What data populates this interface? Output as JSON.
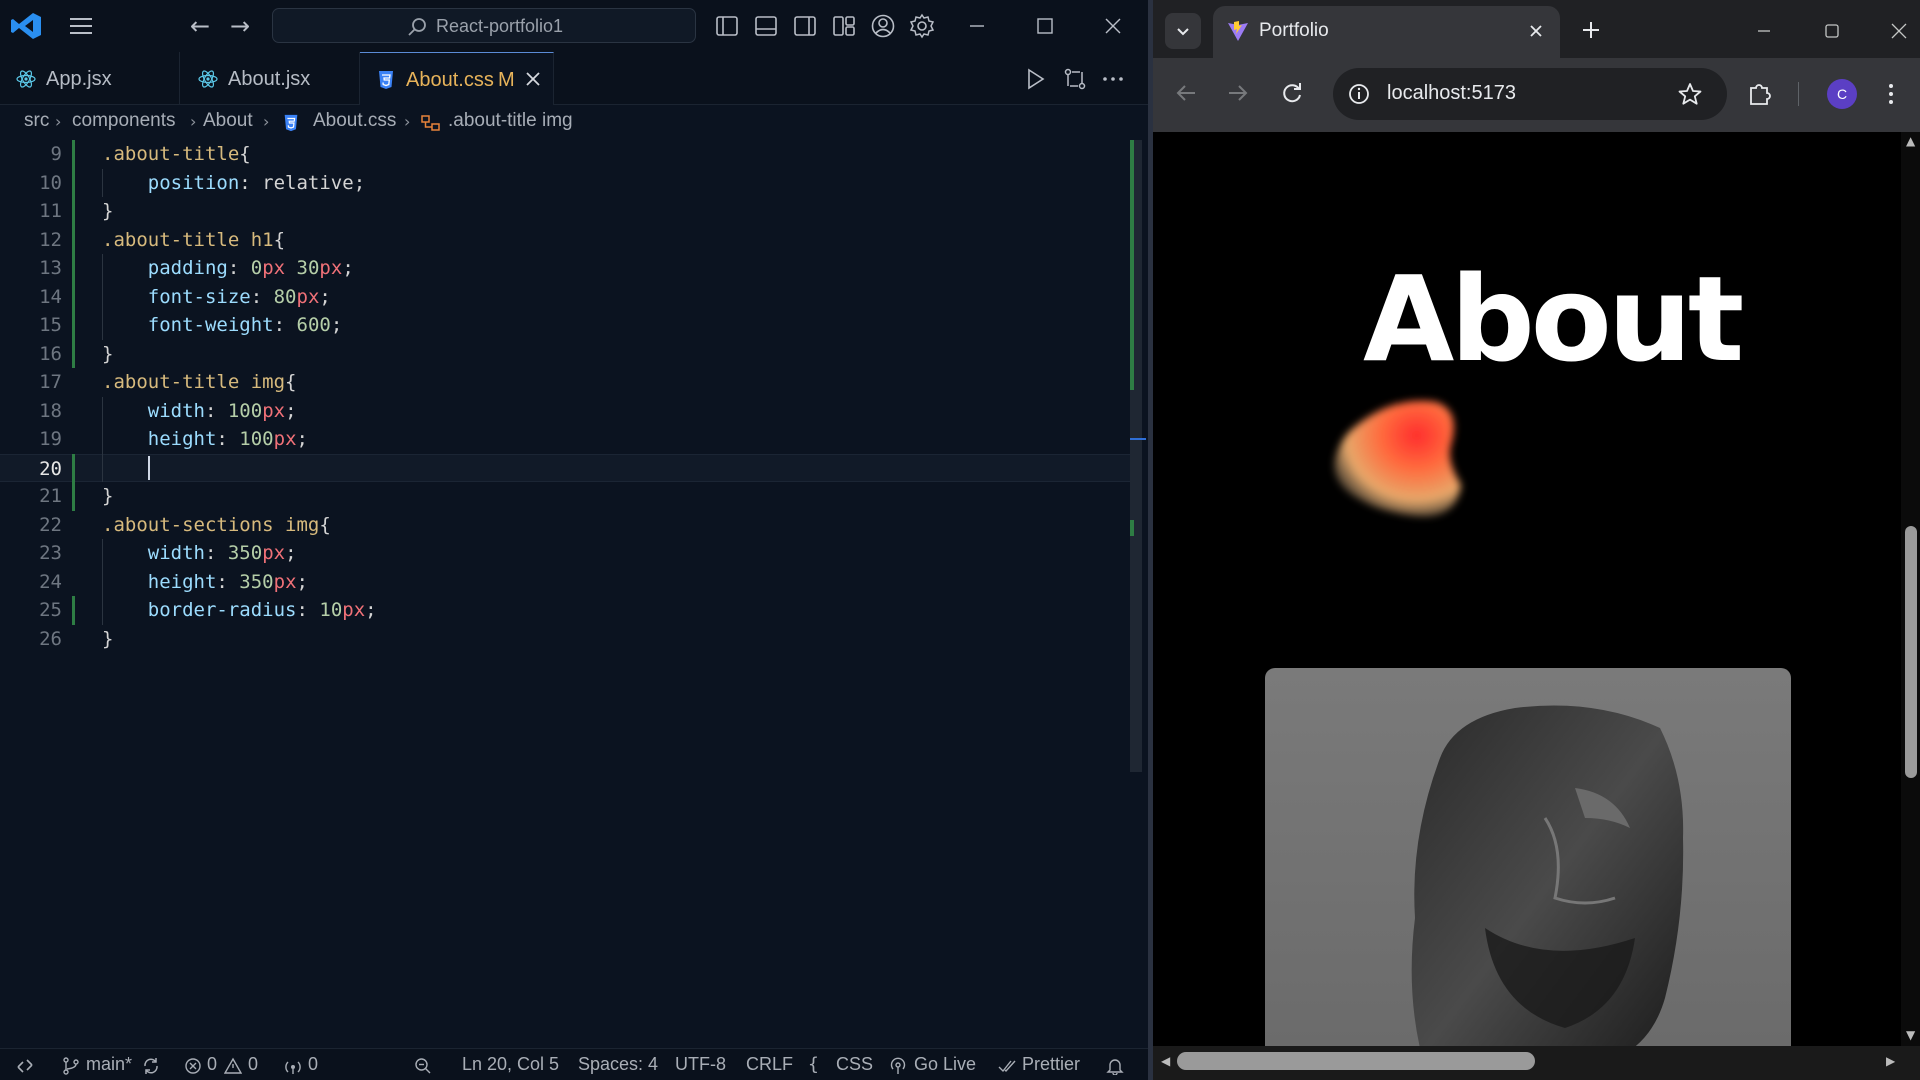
{
  "vscode": {
    "search_text": "React-portfolio1",
    "tabs": [
      {
        "label": "App.jsx",
        "icon": "react-icon"
      },
      {
        "label": "About.jsx",
        "icon": "react-icon"
      },
      {
        "label": "About.css",
        "icon": "css-icon",
        "modified": "M",
        "active": true
      }
    ],
    "breadcrumb": [
      "src",
      "components",
      "About",
      "About.css",
      ".about-title img"
    ],
    "lines": [
      {
        "n": "9",
        "tokens": [
          {
            "t": ".about-title",
            "c": "t-sel"
          },
          {
            "t": "{",
            "c": "t-brace"
          }
        ]
      },
      {
        "n": "10",
        "tokens": [
          {
            "t": "    ",
            "c": ""
          },
          {
            "t": "position",
            "c": "t-prop"
          },
          {
            "t": ": ",
            "c": "t-val"
          },
          {
            "t": "relative",
            "c": "t-val"
          },
          {
            "t": ";",
            "c": "t-val"
          }
        ]
      },
      {
        "n": "11",
        "tokens": [
          {
            "t": "}",
            "c": "t-brace"
          }
        ]
      },
      {
        "n": "12",
        "tokens": [
          {
            "t": ".about-title ",
            "c": "t-sel"
          },
          {
            "t": "h1",
            "c": "t-tag"
          },
          {
            "t": "{",
            "c": "t-brace"
          }
        ]
      },
      {
        "n": "13",
        "tokens": [
          {
            "t": "    ",
            "c": ""
          },
          {
            "t": "padding",
            "c": "t-prop"
          },
          {
            "t": ": ",
            "c": "t-val"
          },
          {
            "t": "0",
            "c": "t-num"
          },
          {
            "t": "px",
            "c": "t-unit"
          },
          {
            "t": " ",
            "c": ""
          },
          {
            "t": "30",
            "c": "t-num"
          },
          {
            "t": "px",
            "c": "t-unit"
          },
          {
            "t": ";",
            "c": "t-val"
          }
        ]
      },
      {
        "n": "14",
        "tokens": [
          {
            "t": "    ",
            "c": ""
          },
          {
            "t": "font-size",
            "c": "t-prop"
          },
          {
            "t": ": ",
            "c": "t-val"
          },
          {
            "t": "80",
            "c": "t-num"
          },
          {
            "t": "px",
            "c": "t-unit"
          },
          {
            "t": ";",
            "c": "t-val"
          }
        ]
      },
      {
        "n": "15",
        "tokens": [
          {
            "t": "    ",
            "c": ""
          },
          {
            "t": "font-weight",
            "c": "t-prop"
          },
          {
            "t": ": ",
            "c": "t-val"
          },
          {
            "t": "600",
            "c": "t-num"
          },
          {
            "t": ";",
            "c": "t-val"
          }
        ]
      },
      {
        "n": "16",
        "tokens": [
          {
            "t": "}",
            "c": "t-brace"
          }
        ]
      },
      {
        "n": "17",
        "tokens": [
          {
            "t": ".about-title ",
            "c": "t-sel"
          },
          {
            "t": "img",
            "c": "t-tag"
          },
          {
            "t": "{",
            "c": "t-brace"
          }
        ]
      },
      {
        "n": "18",
        "tokens": [
          {
            "t": "    ",
            "c": ""
          },
          {
            "t": "width",
            "c": "t-prop"
          },
          {
            "t": ": ",
            "c": "t-val"
          },
          {
            "t": "100",
            "c": "t-num"
          },
          {
            "t": "px",
            "c": "t-unit"
          },
          {
            "t": ";",
            "c": "t-val"
          }
        ]
      },
      {
        "n": "19",
        "tokens": [
          {
            "t": "    ",
            "c": ""
          },
          {
            "t": "height",
            "c": "t-prop"
          },
          {
            "t": ": ",
            "c": "t-val"
          },
          {
            "t": "100",
            "c": "t-num"
          },
          {
            "t": "px",
            "c": "t-unit"
          },
          {
            "t": ";",
            "c": "t-val"
          }
        ]
      },
      {
        "n": "20",
        "tokens": [],
        "current": true
      },
      {
        "n": "21",
        "tokens": [
          {
            "t": "}",
            "c": "t-brace"
          }
        ]
      },
      {
        "n": "22",
        "tokens": [
          {
            "t": ".about-sections ",
            "c": "t-sel"
          },
          {
            "t": "img",
            "c": "t-tag"
          },
          {
            "t": "{",
            "c": "t-brace"
          }
        ]
      },
      {
        "n": "23",
        "tokens": [
          {
            "t": "    ",
            "c": ""
          },
          {
            "t": "width",
            "c": "t-prop"
          },
          {
            "t": ": ",
            "c": "t-val"
          },
          {
            "t": "350",
            "c": "t-num"
          },
          {
            "t": "px",
            "c": "t-unit"
          },
          {
            "t": ";",
            "c": "t-val"
          }
        ]
      },
      {
        "n": "24",
        "tokens": [
          {
            "t": "    ",
            "c": ""
          },
          {
            "t": "height",
            "c": "t-prop"
          },
          {
            "t": ": ",
            "c": "t-val"
          },
          {
            "t": "350",
            "c": "t-num"
          },
          {
            "t": "px",
            "c": "t-unit"
          },
          {
            "t": ";",
            "c": "t-val"
          }
        ]
      },
      {
        "n": "25",
        "tokens": [
          {
            "t": "    ",
            "c": ""
          },
          {
            "t": "border-radius",
            "c": "t-prop"
          },
          {
            "t": ": ",
            "c": "t-val"
          },
          {
            "t": "10",
            "c": "t-num"
          },
          {
            "t": "px",
            "c": "t-unit"
          },
          {
            "t": ";",
            "c": "t-val"
          }
        ]
      },
      {
        "n": "26",
        "tokens": [
          {
            "t": "}",
            "c": "t-brace"
          }
        ]
      }
    ],
    "status": {
      "branch": "main*",
      "errors": "0",
      "warnings": "0",
      "ports": "0",
      "position": "Ln 20, Col 5",
      "spaces": "Spaces: 4",
      "encoding": "UTF-8",
      "eol": "CRLF",
      "language": "CSS",
      "golive": "Go Live",
      "prettier": "Prettier"
    },
    "colors": {
      "accent": "#e7b35a",
      "css_icon": "#3b82f6",
      "react_icon": "#5bc8e8"
    }
  },
  "browser": {
    "tab_title": "Portfolio",
    "url": "localhost:5173",
    "avatar_letter": "C",
    "page_heading": "About"
  }
}
